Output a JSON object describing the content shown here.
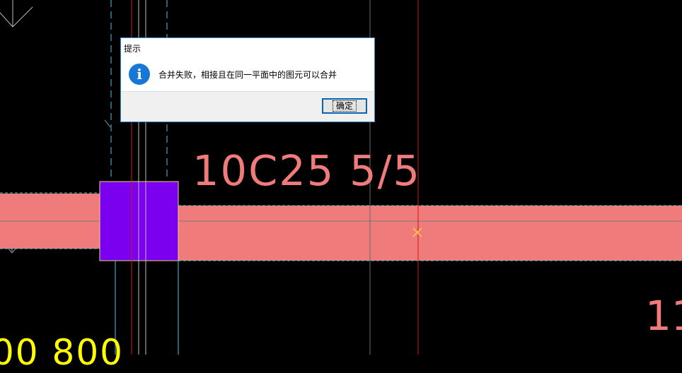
{
  "drawing": {
    "rebar_label": "10C25 5/5",
    "partial_label_right": "11",
    "partial_label_bottom": "00 800",
    "colors": {
      "background": "#000000",
      "beam": "#f07b7b",
      "column": "#7b00f0",
      "axis_line": "#00bcd4",
      "red_line": "#cc1a1a",
      "yellow_text": "#ffff00"
    }
  },
  "dialog": {
    "title": "提示",
    "icon": "info-icon",
    "message": "合并失败，相接且在同一平面中的图元可以合并",
    "ok_label": "确定"
  }
}
